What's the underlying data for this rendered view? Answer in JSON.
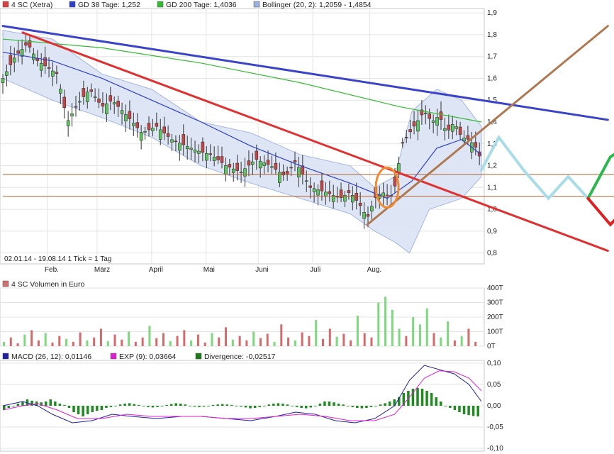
{
  "legend_main": [
    {
      "label": "4 SC (Xetra)",
      "color": "#d94040"
    },
    {
      "label": "GD 38 Tage: 1,252",
      "color": "#2f3fc8"
    },
    {
      "label": "GD 200 Tage: 1,4036",
      "color": "#33bb33"
    },
    {
      "label": "Bollinger (20, 2): 1,2059 - 1,4854",
      "color": "#9bb0dd"
    }
  ],
  "legend_volume": {
    "label": "4 SC Volumen in Euro",
    "color": "#d07070"
  },
  "legend_macd": [
    {
      "label": "MACD (26, 12): 0,01146",
      "color": "#2020a0"
    },
    {
      "label": "EXP (9): 0,03664",
      "color": "#e020d0"
    },
    {
      "label": "Divergence: -0,02517",
      "color": "#1a7a1a"
    }
  ],
  "info_text": "02.01.14 - 19.08.14  1 Tick = 1 Tag",
  "chart_data": [
    {
      "type": "candlestick",
      "title": "4 SC (Xetra)",
      "x_labels": [
        "Feb.",
        "März",
        "April",
        "Mai",
        "Juni",
        "Juli",
        "Aug."
      ],
      "y_ticks": [
        "0,8",
        "0,9",
        "1,0",
        "1,1",
        "1,2",
        "1,3",
        "1,4",
        "1,5",
        "1,6",
        "1,7",
        "1,8",
        "1,9"
      ],
      "ylim": [
        0.75,
        1.92
      ],
      "close_path": [
        [
          0,
          1.6
        ],
        [
          5,
          1.7
        ],
        [
          10,
          1.76
        ],
        [
          14,
          1.68
        ],
        [
          18,
          1.65
        ],
        [
          22,
          1.62
        ],
        [
          26,
          1.4
        ],
        [
          30,
          1.48
        ],
        [
          35,
          1.55
        ],
        [
          40,
          1.47
        ],
        [
          44,
          1.5
        ],
        [
          50,
          1.43
        ],
        [
          56,
          1.35
        ],
        [
          62,
          1.38
        ],
        [
          68,
          1.32
        ],
        [
          72,
          1.3
        ],
        [
          78,
          1.27
        ],
        [
          84,
          1.25
        ],
        [
          90,
          1.2
        ],
        [
          96,
          1.17
        ],
        [
          102,
          1.23
        ],
        [
          108,
          1.2
        ],
        [
          114,
          1.15
        ],
        [
          118,
          1.22
        ],
        [
          124,
          1.1
        ],
        [
          130,
          1.08
        ],
        [
          136,
          1.05
        ],
        [
          140,
          1.08
        ],
        [
          144,
          1.02
        ],
        [
          147,
          0.96
        ],
        [
          150,
          1.05
        ],
        [
          153,
          1.08
        ],
        [
          156,
          1.05
        ],
        [
          158,
          1.1
        ],
        [
          161,
          1.3
        ],
        [
          164,
          1.35
        ],
        [
          167,
          1.4
        ],
        [
          170,
          1.45
        ],
        [
          173,
          1.4
        ],
        [
          176,
          1.43
        ],
        [
          179,
          1.35
        ],
        [
          182,
          1.4
        ],
        [
          185,
          1.33
        ],
        [
          188,
          1.32
        ],
        [
          191,
          1.28
        ],
        [
          193,
          1.22
        ]
      ],
      "gd38_path": [
        [
          0,
          1.72
        ],
        [
          20,
          1.68
        ],
        [
          40,
          1.6
        ],
        [
          60,
          1.5
        ],
        [
          80,
          1.4
        ],
        [
          100,
          1.29
        ],
        [
          120,
          1.2
        ],
        [
          140,
          1.12
        ],
        [
          155,
          1.05
        ],
        [
          165,
          1.13
        ],
        [
          175,
          1.28
        ],
        [
          185,
          1.32
        ],
        [
          193,
          1.25
        ]
      ],
      "gd200_path": [
        [
          0,
          1.78
        ],
        [
          40,
          1.74
        ],
        [
          80,
          1.67
        ],
        [
          120,
          1.58
        ],
        [
          160,
          1.47
        ],
        [
          193,
          1.4
        ]
      ],
      "bollinger_upper": [
        [
          0,
          1.82
        ],
        [
          20,
          1.78
        ],
        [
          40,
          1.62
        ],
        [
          60,
          1.55
        ],
        [
          80,
          1.4
        ],
        [
          100,
          1.35
        ],
        [
          120,
          1.25
        ],
        [
          140,
          1.2
        ],
        [
          150,
          1.1
        ],
        [
          158,
          1.15
        ],
        [
          165,
          1.45
        ],
        [
          175,
          1.55
        ],
        [
          185,
          1.5
        ],
        [
          193,
          1.38
        ]
      ],
      "bollinger_lower": [
        [
          0,
          1.6
        ],
        [
          20,
          1.5
        ],
        [
          40,
          1.42
        ],
        [
          60,
          1.33
        ],
        [
          80,
          1.2
        ],
        [
          100,
          1.12
        ],
        [
          120,
          1.05
        ],
        [
          140,
          0.98
        ],
        [
          150,
          0.9
        ],
        [
          158,
          0.85
        ],
        [
          164,
          0.8
        ],
        [
          172,
          1.0
        ],
        [
          185,
          1.05
        ],
        [
          193,
          1.15
        ]
      ],
      "trendline_blue": [
        [
          0,
          1.84
        ],
        [
          244,
          1.41
        ]
      ],
      "trendline_red": [
        [
          8,
          1.81
        ],
        [
          244,
          0.81
        ]
      ],
      "trendline_brown": [
        [
          147,
          0.93
        ],
        [
          244,
          1.84
        ]
      ],
      "hline_1": 1.16,
      "hline_2": 1.06,
      "scenario_light_blue": [
        [
          193,
          1.18
        ],
        [
          200,
          1.33
        ],
        [
          210,
          1.18
        ],
        [
          220,
          1.05
        ],
        [
          228,
          1.15
        ],
        [
          236,
          1.05
        ]
      ],
      "scenario_green": [
        [
          236,
          1.05
        ],
        [
          245,
          1.24
        ],
        [
          253,
          1.3
        ],
        [
          263,
          1.37
        ]
      ],
      "scenario_red": [
        [
          236,
          1.05
        ],
        [
          245,
          0.93
        ],
        [
          255,
          1.05
        ],
        [
          263,
          0.85
        ]
      ]
    },
    {
      "type": "bar",
      "title": "4 SC Volumen in Euro",
      "y_ticks": [
        "0T",
        "100T",
        "200T",
        "300T",
        "400T"
      ],
      "ylim": [
        0,
        400
      ],
      "values": [
        30,
        60,
        20,
        80,
        110,
        40,
        90,
        25,
        70,
        50,
        30,
        95,
        40,
        60,
        120,
        35,
        80,
        45,
        100,
        30,
        60,
        140,
        55,
        90,
        35,
        70,
        110,
        40,
        80,
        25,
        90,
        60,
        130,
        45,
        70,
        40,
        100,
        55,
        85,
        30,
        150,
        60,
        40,
        95,
        70,
        180,
        50,
        120,
        65,
        85,
        40,
        210,
        90,
        60,
        300,
        340,
        250,
        120,
        70,
        200,
        150,
        260,
        90,
        60,
        170,
        40,
        70,
        120,
        30
      ]
    },
    {
      "type": "line",
      "title": "MACD (26, 12)",
      "y_ticks": [
        "-0,10",
        "-0,05",
        "0,00",
        "0,05",
        "0,10"
      ],
      "ylim": [
        -0.1,
        0.1
      ],
      "series": [
        {
          "name": "MACD (26, 12)",
          "points": [
            [
              0,
              0.0
            ],
            [
              8,
              0.01
            ],
            [
              14,
              0.0
            ],
            [
              20,
              -0.02
            ],
            [
              28,
              -0.04
            ],
            [
              36,
              -0.035
            ],
            [
              44,
              -0.02
            ],
            [
              52,
              -0.025
            ],
            [
              62,
              -0.03
            ],
            [
              72,
              -0.025
            ],
            [
              80,
              -0.025
            ],
            [
              90,
              -0.03
            ],
            [
              100,
              -0.035
            ],
            [
              110,
              -0.025
            ],
            [
              118,
              -0.015
            ],
            [
              126,
              -0.02
            ],
            [
              134,
              -0.035
            ],
            [
              142,
              -0.04
            ],
            [
              150,
              -0.03
            ],
            [
              158,
              0.0
            ],
            [
              164,
              0.06
            ],
            [
              170,
              0.095
            ],
            [
              176,
              0.085
            ],
            [
              182,
              0.075
            ],
            [
              188,
              0.05
            ],
            [
              193,
              0.01
            ]
          ]
        },
        {
          "name": "EXP (9)",
          "points": [
            [
              0,
              -0.01
            ],
            [
              8,
              0.0
            ],
            [
              14,
              0.005
            ],
            [
              22,
              -0.01
            ],
            [
              30,
              -0.03
            ],
            [
              40,
              -0.03
            ],
            [
              50,
              -0.02
            ],
            [
              60,
              -0.025
            ],
            [
              70,
              -0.025
            ],
            [
              80,
              -0.025
            ],
            [
              90,
              -0.03
            ],
            [
              100,
              -0.03
            ],
            [
              110,
              -0.025
            ],
            [
              120,
              -0.02
            ],
            [
              130,
              -0.025
            ],
            [
              140,
              -0.035
            ],
            [
              150,
              -0.035
            ],
            [
              158,
              -0.02
            ],
            [
              164,
              0.02
            ],
            [
              170,
              0.065
            ],
            [
              176,
              0.082
            ],
            [
              182,
              0.08
            ],
            [
              188,
              0.065
            ],
            [
              193,
              0.035
            ]
          ]
        }
      ],
      "divergence": [
        -0.01,
        -0.005,
        0.0,
        0.005,
        0.01,
        0.015,
        0.012,
        0.01,
        0.008,
        0.01,
        0.015,
        0.01,
        0.005,
        0.002,
        -0.005,
        -0.015,
        -0.02,
        -0.025,
        -0.02,
        -0.015,
        -0.012,
        -0.01,
        -0.005,
        -0.003,
        0.0,
        0.003,
        0.005,
        0.006,
        0.004,
        0.002,
        0.0,
        -0.003,
        -0.004,
        -0.003,
        0.0,
        0.002,
        0.004,
        0.006,
        0.005,
        0.003,
        0.0,
        -0.002,
        -0.003,
        -0.002,
        0.0,
        0.002,
        0.003,
        0.004,
        0.003,
        0.002,
        0.0,
        -0.002,
        -0.004,
        -0.006,
        -0.005,
        -0.003,
        0.0,
        0.003,
        0.005,
        0.006,
        0.005,
        0.003,
        0.0,
        -0.003,
        -0.005,
        -0.006,
        -0.004,
        0.0,
        0.005,
        0.01,
        0.01,
        0.008,
        0.005,
        0.003,
        0.0,
        -0.003,
        -0.005,
        -0.006,
        -0.005,
        -0.003,
        0.0,
        0.003,
        0.006,
        0.01,
        0.015,
        0.02,
        0.03,
        0.035,
        0.04,
        0.042,
        0.04,
        0.035,
        0.03,
        0.02,
        0.01,
        0.0,
        -0.005,
        -0.01,
        -0.015,
        -0.02,
        -0.022,
        -0.024,
        -0.025
      ]
    }
  ]
}
